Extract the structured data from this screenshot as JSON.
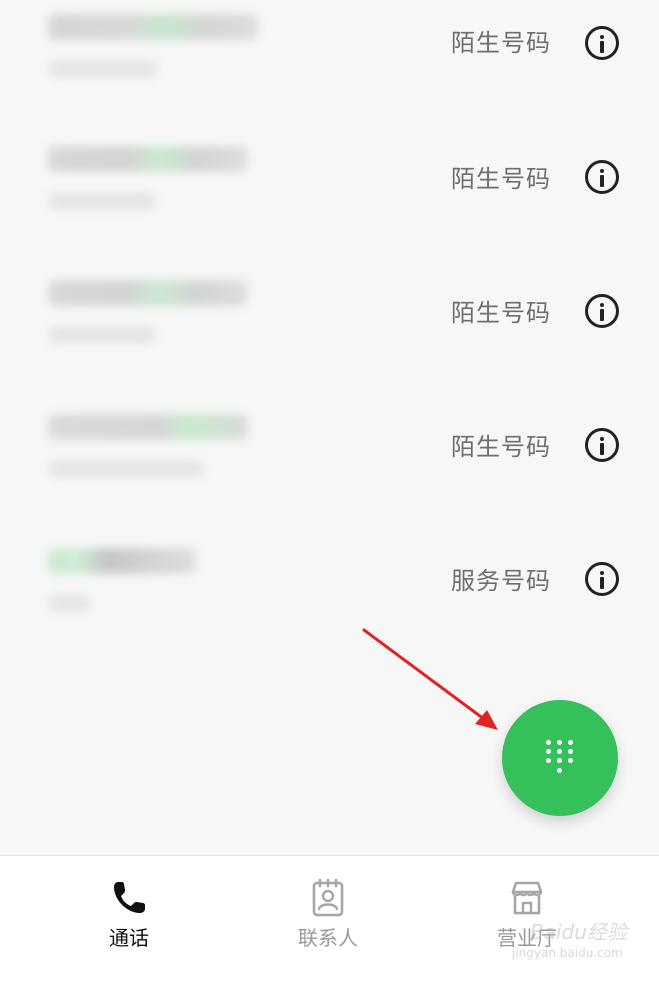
{
  "calls": [
    {
      "tag": "陌生号码"
    },
    {
      "tag": "陌生号码"
    },
    {
      "tag": "陌生号码"
    },
    {
      "tag": "陌生号码"
    },
    {
      "tag": "服务号码"
    }
  ],
  "fab": {
    "icon": "dialpad-icon",
    "color": "#35c05b"
  },
  "tabbar": {
    "tabs": [
      {
        "label": "通话",
        "icon": "phone-icon",
        "active": true
      },
      {
        "label": "联系人",
        "icon": "contacts-icon",
        "active": false
      },
      {
        "label": "营业厅",
        "icon": "store-icon",
        "active": false
      }
    ]
  },
  "watermark": {
    "main": "Baidu经验",
    "url": "jingyan.baidu.com"
  },
  "colors": {
    "accent": "#35c05b",
    "arrow": "#e02424",
    "tag_text": "#6e6e6e"
  }
}
